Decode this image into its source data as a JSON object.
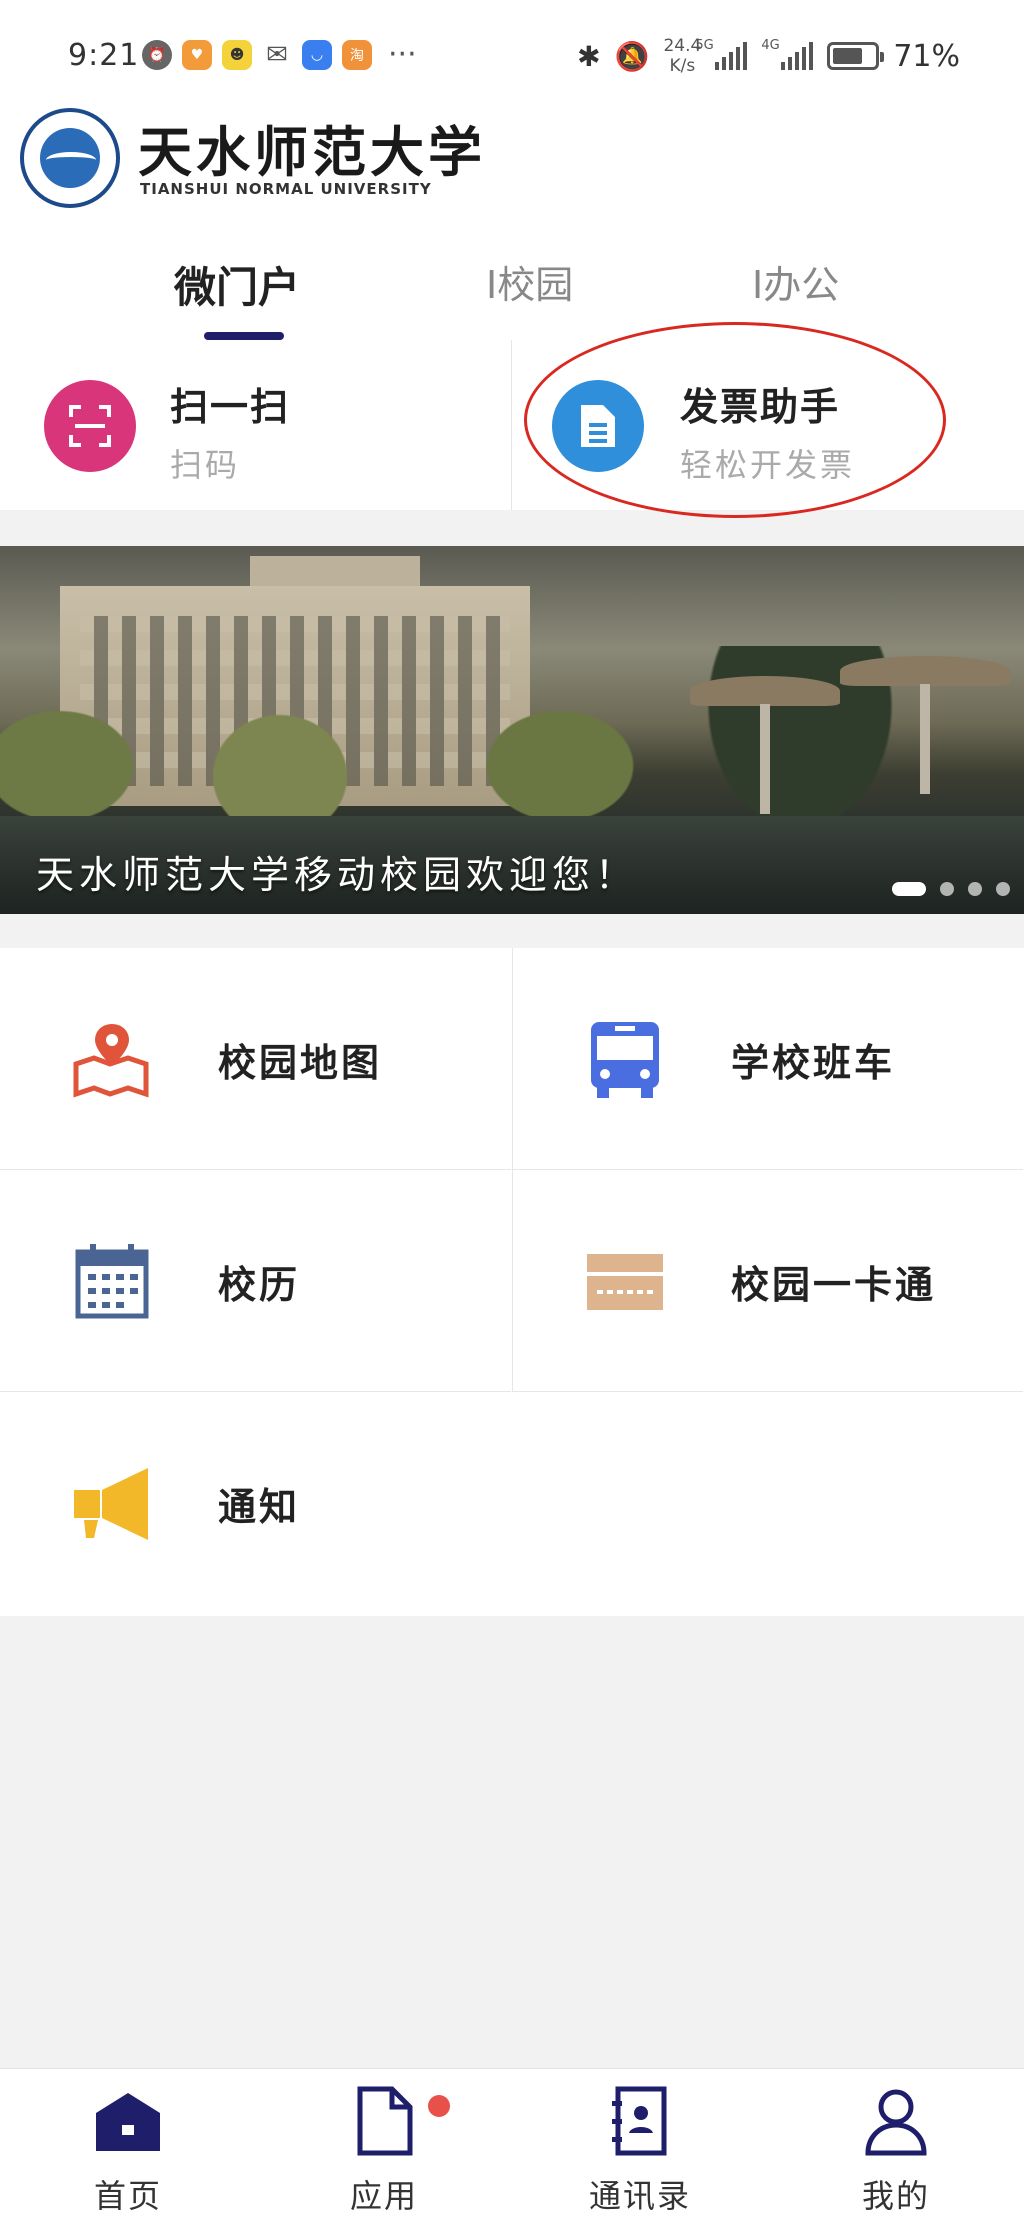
{
  "status_bar": {
    "time": "9:21",
    "speed_value": "24.4",
    "speed_unit": "K/s",
    "net_tag_1": "5G",
    "net_tag_2": "4G",
    "battery_percent": "71%",
    "battery_level": 0.71,
    "more": "···"
  },
  "header": {
    "school_name": "天水师范大学",
    "school_name_en": "TIANSHUI NORMAL UNIVERSITY"
  },
  "tabs": [
    {
      "label": "微门户",
      "active": true
    },
    {
      "label": "I校园",
      "active": false
    },
    {
      "label": "I办公",
      "active": false
    }
  ],
  "quick_actions": [
    {
      "title": "扫一扫",
      "subtitle": "扫码",
      "icon": "scan-icon",
      "color": "#d8357a"
    },
    {
      "title": "发票助手",
      "subtitle": "轻松开发票",
      "icon": "document-icon",
      "color": "#2f8fdb"
    }
  ],
  "banner": {
    "caption": "天水师范大学移动校园欢迎您！",
    "slide_count": 4,
    "active_slide": 1
  },
  "grid": [
    {
      "label": "校园地图",
      "icon": "map-pin-icon",
      "color": "#e0543a"
    },
    {
      "label": "学校班车",
      "icon": "bus-icon",
      "color": "#4a6ee0"
    },
    {
      "label": "校历",
      "icon": "calendar-icon",
      "color": "#4a6494"
    },
    {
      "label": "校园一卡通",
      "icon": "card-icon",
      "color": "#deb48e"
    },
    {
      "label": "通知",
      "icon": "megaphone-icon",
      "color": "#f2b829"
    }
  ],
  "bottom_nav": [
    {
      "label": "首页",
      "icon": "home-icon",
      "active": true
    },
    {
      "label": "应用",
      "icon": "apps-icon",
      "active": false,
      "badge": true
    },
    {
      "label": "通讯录",
      "icon": "contacts-icon",
      "active": false
    },
    {
      "label": "我的",
      "icon": "profile-icon",
      "active": false
    }
  ],
  "colors": {
    "primary": "#1f1e6b",
    "highlight": "#d9281f",
    "badge": "#e8514a"
  }
}
